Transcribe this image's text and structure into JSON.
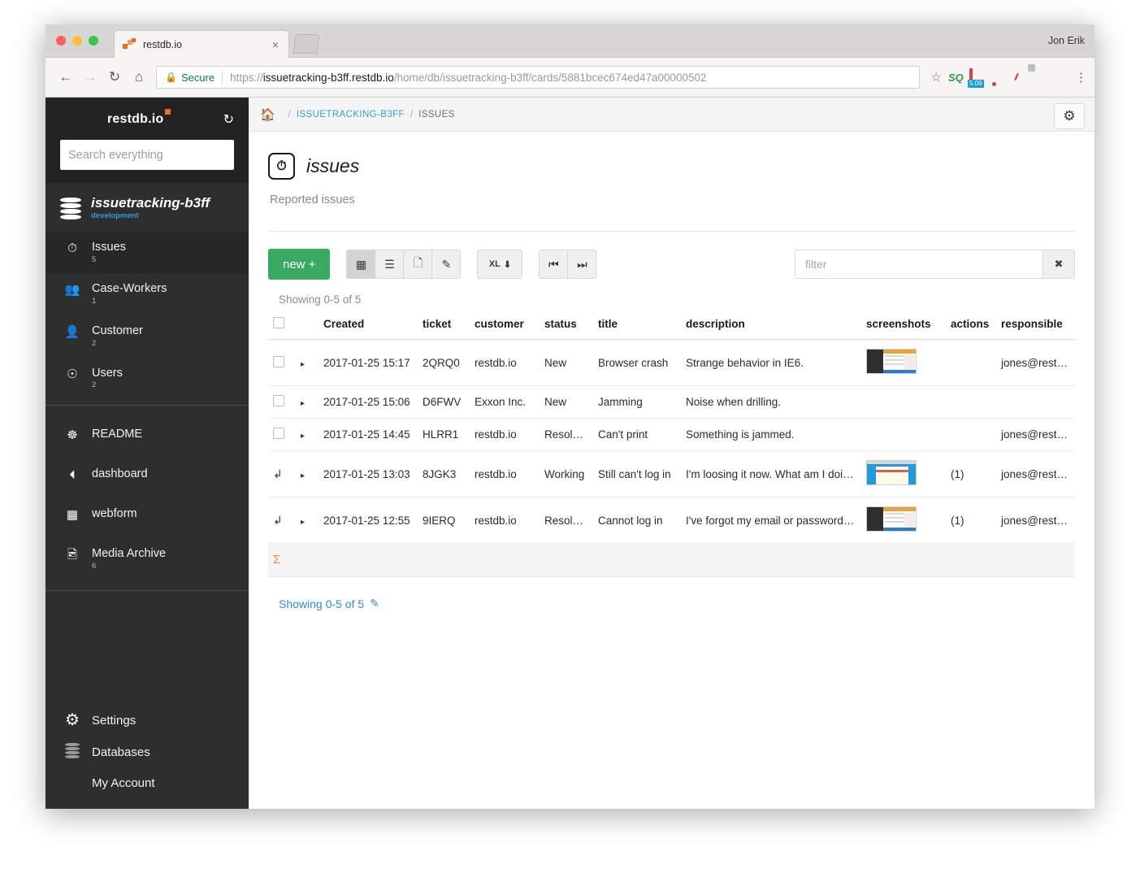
{
  "browser": {
    "tab": {
      "title": "restdb.io",
      "favicon": "restdb-logo-icon",
      "close": "×"
    },
    "user_label": "Jon Erik",
    "nav": {
      "back": "←",
      "forward": "→",
      "reload": "↻",
      "home": "⌂"
    },
    "omnibox": {
      "lock_icon": "🔒",
      "secure_label": "Secure",
      "url_scheme": "https://",
      "url_host": "issuetracking-b3ff.restdb.io",
      "url_path": "/home/db/issuetracking-b3ff/cards/5881bcec674ed47a00000502",
      "star_icon": "☆"
    },
    "extensions": [
      "sq-icon",
      "rainbow-badge-icon",
      "evernote-icon",
      "gauge-icon",
      "google-docs-icon",
      "color-wheel-icon"
    ],
    "menu_icon": "⋮"
  },
  "sidebar": {
    "brand": "restdb.io",
    "refresh_icon": "↻",
    "search": {
      "placeholder": "Search everything",
      "value": ""
    },
    "database": {
      "name": "issuetracking-b3ff",
      "env": "development",
      "icon": "database-icon"
    },
    "collections": [
      {
        "label": "Issues",
        "count": "5",
        "icon": "issues-icon",
        "active": true
      },
      {
        "label": "Case-Workers",
        "count": "1",
        "icon": "users-group-icon",
        "active": false
      },
      {
        "label": "Customer",
        "count": "2",
        "icon": "person-icon",
        "active": false
      },
      {
        "label": "Users",
        "count": "2",
        "icon": "user-circle-icon",
        "active": false
      }
    ],
    "pages": [
      {
        "label": "README",
        "count": "",
        "icon": "lifebuoy-icon"
      },
      {
        "label": "dashboard",
        "count": "",
        "icon": "dashboard-icon"
      },
      {
        "label": "webform",
        "count": "",
        "icon": "webform-icon"
      },
      {
        "label": "Media Archive",
        "count": "6",
        "icon": "media-image-icon"
      }
    ],
    "bottom": [
      {
        "label": "Settings",
        "icon": "gear-icon"
      },
      {
        "label": "Databases",
        "icon": "database-icon"
      },
      {
        "label": "My Account",
        "icon": "avatar-icon"
      }
    ]
  },
  "breadcrumb": {
    "home_icon": "🏠",
    "items": [
      "ISSUETRACKING-B3FF",
      "ISSUES"
    ],
    "separator": "/"
  },
  "page": {
    "icon": "issues-icon",
    "title": "issues",
    "subtitle": "Reported issues",
    "settings_gear": "⚙"
  },
  "toolbar": {
    "new_label": "new",
    "new_plus": "+",
    "view_buttons": [
      {
        "name": "table-view",
        "icon": "▦",
        "active": true
      },
      {
        "name": "list-view",
        "icon": "☰",
        "active": false
      },
      {
        "name": "report-view",
        "icon": "☷",
        "active": false
      },
      {
        "name": "edit-view",
        "icon": "✎",
        "active": false
      }
    ],
    "excel_label": "XL",
    "excel_icon": "⬇",
    "page_first": "⏮",
    "page_last": "⏭",
    "filter": {
      "placeholder": "filter",
      "value": "",
      "clear_icon": "✖"
    }
  },
  "table": {
    "showing_top": "Showing 0-5 of 5",
    "showing_bottom": "Showing 0-5 of 5",
    "showing_bottom_icon": "✎",
    "sum_icon": "Σ",
    "columns": [
      "",
      "",
      "Created",
      "ticket",
      "customer",
      "status",
      "title",
      "description",
      "screenshots",
      "actions",
      "responsible"
    ],
    "rows": [
      {
        "marker": "checkbox",
        "expand": "▸",
        "created": "2017-01-25 15:17",
        "ticket": "2QRQ0",
        "customer": "restdb.io",
        "status": "New",
        "title": "Browser crash",
        "description": "Strange behavior in IE6.",
        "screenshot": "dark-dashboard-thumb",
        "actions": "",
        "responsible": "jones@restdb.io Jonnie C"
      },
      {
        "marker": "checkbox",
        "expand": "▸",
        "created": "2017-01-25 15:06",
        "ticket": "D6FWV",
        "customer": "Exxon Inc.",
        "status": "New",
        "title": "Jamming",
        "description": "Noise when drilling.",
        "screenshot": "",
        "actions": "",
        "responsible": ""
      },
      {
        "marker": "checkbox",
        "expand": "▸",
        "created": "2017-01-25 14:45",
        "ticket": "HLRR1",
        "customer": "restdb.io",
        "status": "Resolved",
        "title": "Can't print",
        "description": "Something is jammed.",
        "screenshot": "",
        "actions": "",
        "responsible": "jones@restdb.io Jonnie C"
      },
      {
        "marker": "reply",
        "expand": "▸",
        "created": "2017-01-25 13:03",
        "ticket": "8JGK3",
        "customer": "restdb.io",
        "status": "Working",
        "title": "Still can't log in",
        "description": "I'm loosing it now. What am I doin...",
        "screenshot": "blue-login-thumb",
        "actions": "(1)",
        "responsible": "jones@restdb.io Jonnie C"
      },
      {
        "marker": "reply",
        "expand": "▸",
        "created": "2017-01-25 12:55",
        "ticket": "9IERQ",
        "customer": "restdb.io",
        "status": "Resolved",
        "title": "Cannot log in",
        "description": "I've forgot my email or password. ...",
        "screenshot": "dark-dashboard-thumb",
        "actions": "(1)",
        "responsible": "jones@restdb.io Jonnie C"
      }
    ]
  },
  "colors": {
    "accent_green": "#3aaa63",
    "link_blue": "#2d8fc9",
    "sidebar_bg": "#2e2e2e",
    "brand_orange": "#f1672a",
    "env_blue": "#2f9fd0",
    "sum_orange": "#e88b2e"
  }
}
